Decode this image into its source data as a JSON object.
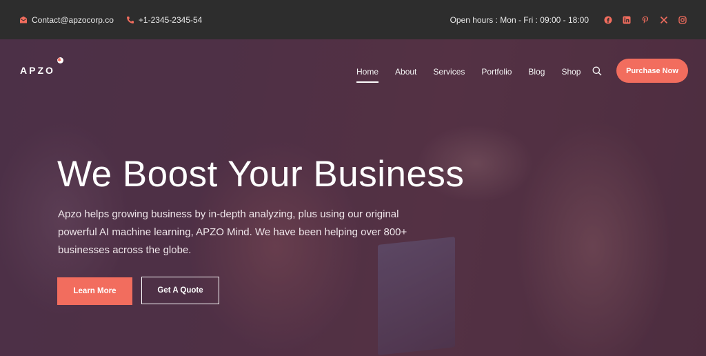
{
  "topbar": {
    "email": "Contact@apzocorp.co",
    "phone": "+1-2345-2345-54",
    "hours": "Open hours : Mon - Fri : 09:00 - 18:00",
    "social": [
      "facebook-icon",
      "linkedin-icon",
      "pinterest-icon",
      "x-icon",
      "instagram-icon"
    ]
  },
  "header": {
    "logo": "APZO",
    "nav": [
      "Home",
      "About",
      "Services",
      "Portfolio",
      "Blog",
      "Shop"
    ],
    "active_nav": "Home",
    "cta": "Purchase Now"
  },
  "hero": {
    "title": "We Boost Your Business",
    "description": "Apzo helps growing business by in-depth analyzing, plus using our original powerful AI machine learning, APZO Mind. We have been helping over 800+ businesses across the globe.",
    "primary_button": "Learn More",
    "secondary_button": "Get A Quote"
  },
  "colors": {
    "accent": "#f26d5e",
    "topbar_bg": "#2d2d2d"
  }
}
